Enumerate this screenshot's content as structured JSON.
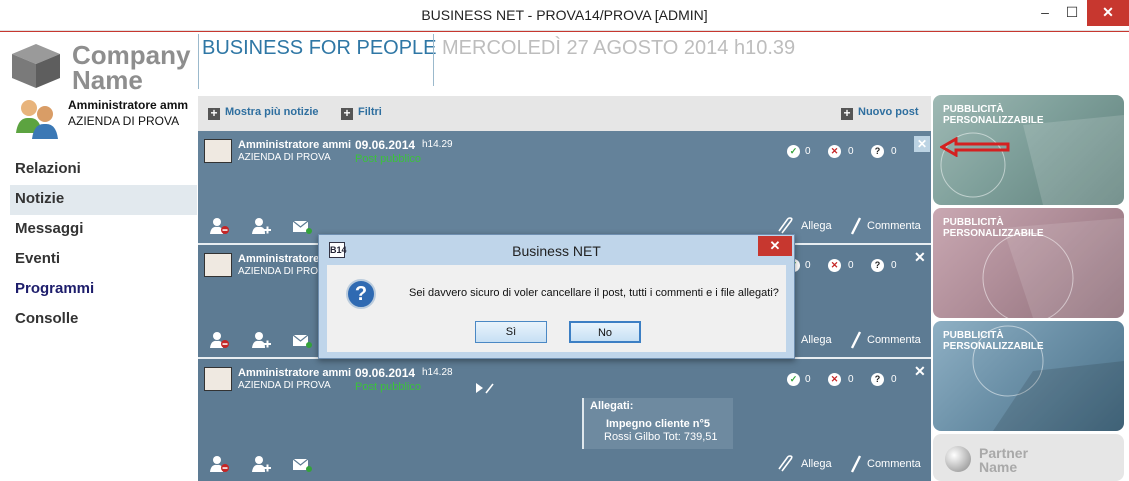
{
  "window": {
    "title": "BUSINESS NET - PROVA14/PROVA [ADMIN]",
    "min": "–",
    "max": "☐",
    "close": "✕"
  },
  "logo": {
    "line1": "Company",
    "line2": "Name"
  },
  "user": {
    "name": "Amministratore amm",
    "company": "AZIENDA DI PROVA"
  },
  "nav": [
    "Relazioni",
    "Notizie",
    "Messaggi",
    "Eventi",
    "Programmi",
    "Consolle"
  ],
  "header": {
    "title": "BUSINESS FOR PEOPLE",
    "date": "MERCOLEDÌ 27 AGOSTO 2014 h10.39"
  },
  "toolbar": {
    "more_news": "Mostra più notizie",
    "filters": "Filtri",
    "new_post": "Nuovo post"
  },
  "posts": [
    {
      "author": "Amministratore ammi",
      "company": "AZIENDA DI PROVA",
      "date": "09.06.2014",
      "time": "h14.29",
      "visibility": "Post pubblico",
      "ok": "0",
      "no": "0",
      "q": "0",
      "attach": "Allega",
      "comment": "Commenta"
    },
    {
      "author": "Amministratore ammi",
      "company": "AZIENDA DI PROVA",
      "date": "",
      "time": "",
      "visibility": "",
      "ok": "0",
      "no": "0",
      "q": "0",
      "attach": "Allega",
      "comment": "Commenta"
    },
    {
      "author": "Amministratore ammi",
      "company": "AZIENDA DI PROVA",
      "date": "09.06.2014",
      "time": "h14.28",
      "visibility": "Post pubblico",
      "ok": "0",
      "no": "0",
      "q": "0",
      "attach": "Allega",
      "comment": "Commenta"
    }
  ],
  "attachments": {
    "header": "Allegati:",
    "name": "Impegno cliente n°5",
    "detail": "Rossi Gilbo  Tot: 739,51"
  },
  "ads": [
    {
      "l1": "PUBBLICITÀ",
      "l2": "PERSONALIZZABILE"
    },
    {
      "l1": "PUBBLICITÀ",
      "l2": "PERSONALIZZABILE"
    },
    {
      "l1": "PUBBLICITÀ",
      "l2": "PERSONALIZZABILE"
    }
  ],
  "partner": {
    "l1": "Partner",
    "l2": "Name"
  },
  "dialog": {
    "title": "Business NET",
    "icon": "B14",
    "message": "Sei davvero sicuro di voler cancellare il post, tutti i commenti e i file allegati?",
    "yes": "Sì",
    "no": "No",
    "close": "✕"
  }
}
